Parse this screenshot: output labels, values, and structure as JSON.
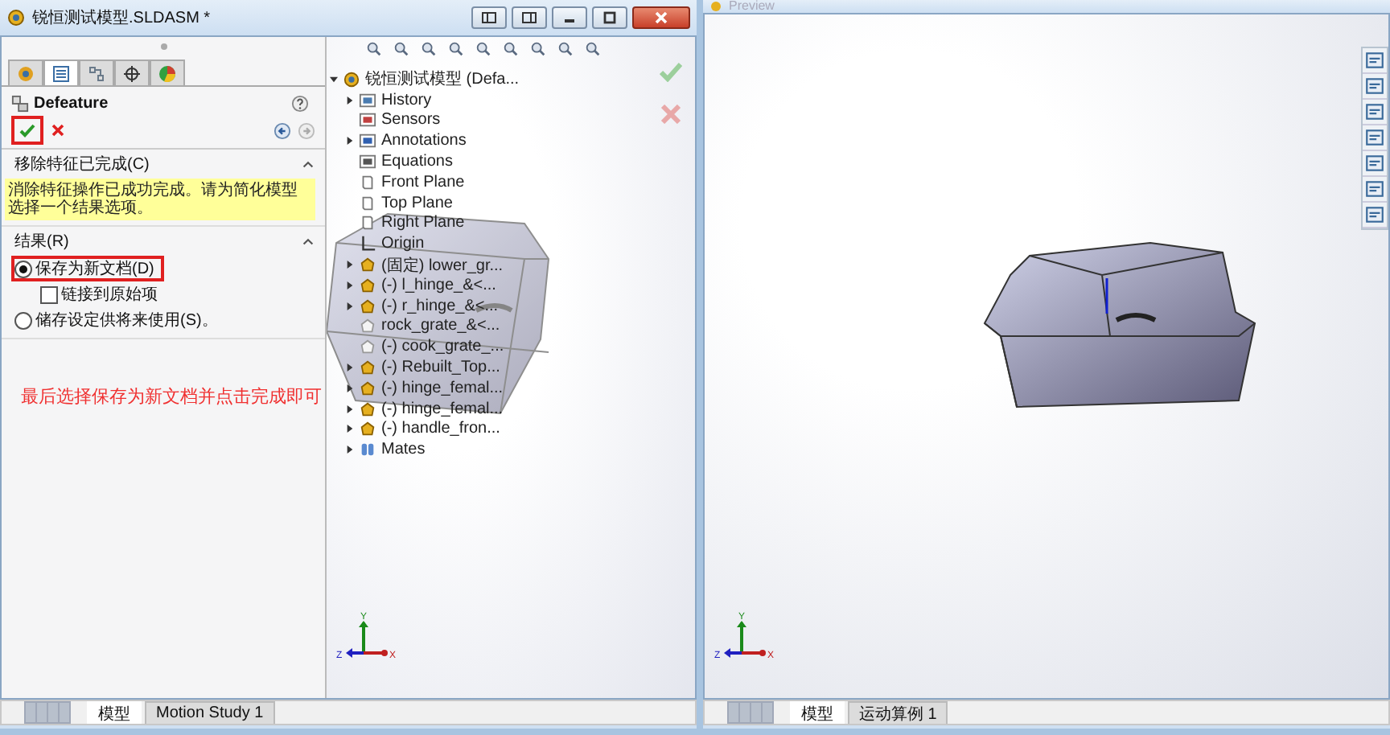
{
  "left_window": {
    "title": "锐恒测试模型.SLDASM *",
    "property_manager": {
      "tabs": [
        {
          "kind": "feature",
          "selected": false
        },
        {
          "kind": "property",
          "selected": true
        },
        {
          "kind": "config",
          "selected": false
        },
        {
          "kind": "target",
          "selected": false
        },
        {
          "kind": "display",
          "selected": false
        }
      ],
      "title": "Defeature",
      "ok_highlighted": true,
      "sections": [
        {
          "title": "移除特征已完成(C)",
          "expanded": true,
          "message": "消除特征操作已成功完成。请为简化模型选择一个结果选项。"
        },
        {
          "title": "结果(R)",
          "expanded": true,
          "options": [
            {
              "kind": "radio",
              "label": "保存为新文档(D)",
              "selected": true,
              "highlighted": true
            },
            {
              "kind": "checkbox",
              "label": "链接到原始项",
              "checked": false
            },
            {
              "kind": "radio",
              "label": "储存设定供将来使用(S)。",
              "selected": false,
              "highlighted": false
            }
          ]
        }
      ],
      "annotation": "最后选择保存为新文档并点击完成即可"
    },
    "feature_tree": {
      "root": "锐恒测试模型 (Defa...",
      "expanded": true,
      "children": [
        {
          "label": "History",
          "kind": "history",
          "expandable": true
        },
        {
          "label": "Sensors",
          "kind": "sensors",
          "expandable": false
        },
        {
          "label": "Annotations",
          "kind": "annotations",
          "expandable": true
        },
        {
          "label": "Equations",
          "kind": "equations",
          "expandable": false
        },
        {
          "label": "Front Plane",
          "kind": "plane",
          "expandable": false
        },
        {
          "label": "Top Plane",
          "kind": "plane",
          "expandable": false
        },
        {
          "label": "Right Plane",
          "kind": "plane",
          "expandable": false
        },
        {
          "label": "Origin",
          "kind": "origin",
          "expandable": false
        },
        {
          "label": "(固定) lower_gr...",
          "kind": "part",
          "expandable": true
        },
        {
          "label": "(-) l_hinge_&<...",
          "kind": "part",
          "expandable": true
        },
        {
          "label": "(-) r_hinge_&<...",
          "kind": "part",
          "expandable": true
        },
        {
          "label": "rock_grate_&<...",
          "kind": "suppressed",
          "expandable": false
        },
        {
          "label": "(-) cook_grate_...",
          "kind": "suppressed",
          "expandable": false
        },
        {
          "label": "(-) Rebuilt_Top...",
          "kind": "part",
          "expandable": true
        },
        {
          "label": "(-) hinge_femal...",
          "kind": "part",
          "expandable": true
        },
        {
          "label": "(-) hinge_femal...",
          "kind": "part",
          "expandable": true
        },
        {
          "label": "(-) handle_fron...",
          "kind": "part",
          "expandable": true
        },
        {
          "label": "Mates",
          "kind": "mates",
          "expandable": true
        }
      ]
    },
    "triad": {
      "x": "X",
      "y": "Y",
      "z": "Z"
    },
    "bottom_tabs": [
      {
        "label": "模型",
        "selected": true
      },
      {
        "label": "Motion Study 1",
        "selected": false
      }
    ]
  },
  "right_window": {
    "title": "Preview",
    "triad": {
      "x": "X",
      "y": "Y",
      "z": "Z"
    },
    "bottom_tabs": [
      {
        "label": "模型",
        "selected": true
      },
      {
        "label": "运动算例 1",
        "selected": false
      }
    ]
  }
}
